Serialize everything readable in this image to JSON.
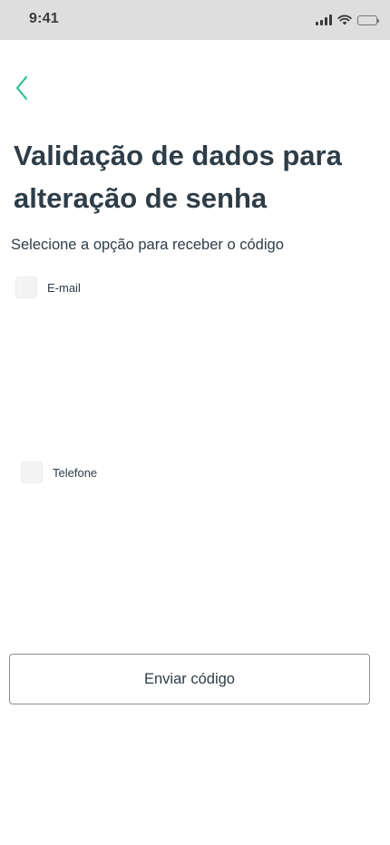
{
  "status_bar": {
    "time": "9:41",
    "icons": [
      "signal-icon",
      "wifi-icon",
      "battery-icon"
    ],
    "battery_level": 1.0
  },
  "header": {
    "back_icon": "chevron-left-icon",
    "back_color": "#1fbf8f"
  },
  "main": {
    "title": "Validação de dados para alteração de senha",
    "subtitle": "Selecione a opção para receber o código",
    "options": [
      {
        "label": "E-mail",
        "checked": false
      },
      {
        "label": "Telefone",
        "checked": false
      }
    ],
    "submit_label": "Enviar código"
  },
  "colors": {
    "text": "#2e3d48",
    "status_bar_bg": "#dedede",
    "accent": "#1fbf8f",
    "checkbox_bg": "#f4f4f4",
    "button_border": "#8e8e8e"
  }
}
